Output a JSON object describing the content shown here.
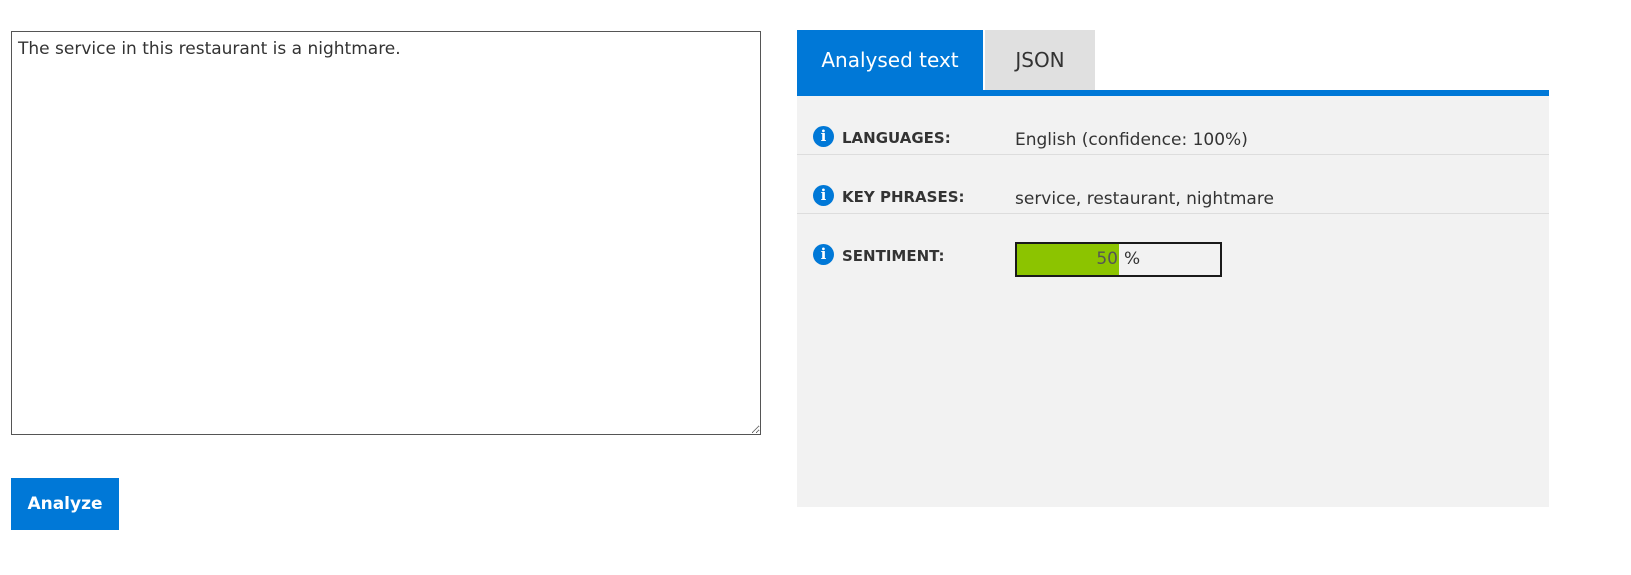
{
  "input": {
    "text": "The service in this restaurant is a nightmare."
  },
  "analyze_button": {
    "label": "Analyze"
  },
  "tabs": [
    {
      "label": "Analysed text",
      "active": true
    },
    {
      "label": "JSON",
      "active": false
    }
  ],
  "results": {
    "languages": {
      "label": "LANGUAGES:",
      "value": "English (confidence: 100%)",
      "icon": "info-icon"
    },
    "key_phrases": {
      "label": "KEY PHRASES:",
      "value": "service, restaurant, nightmare",
      "icon": "info-icon"
    },
    "sentiment": {
      "label": "SENTIMENT:",
      "percent": 50,
      "percent_text": "50",
      "unit": "%",
      "icon": "info-icon"
    }
  },
  "colors": {
    "accent": "#0078d7",
    "sentiment_fill": "#8cc400",
    "inactive_tab": "#e0e0e0",
    "panel_background": "#f2f2f2"
  }
}
